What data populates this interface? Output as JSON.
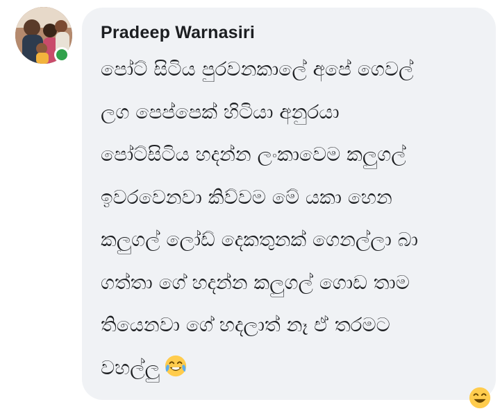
{
  "comment": {
    "author": "Pradeep Warnasiri",
    "lines": [
      "පෝට් සිටිය පුරවනකාලේ අපේ ගෙවල්",
      "ලග පෙප්පෙක් හිටියා අනුරයා",
      "පෝට්සිටිය හදන්න ලංකාවෙම කලුගල්",
      "ඉවරවෙනවා කිව්වම මේ යකා හෙන",
      "කලුගල් ලෝඩ් දෙකතුනක් ගෙනල්ලා බා",
      "ගත්තා ගේ හදන්න කලුගල් ගොඩ තාම",
      "තියෙනවා ගේ හදලාත් නෑ ඒ තරමට",
      "වහල්ලු"
    ],
    "emoji": "face-with-tears-of-joy-icon"
  },
  "colors": {
    "bubble_bg": "#f0f2f5",
    "author_text": "#1c1e21",
    "online": "#31a24c"
  }
}
